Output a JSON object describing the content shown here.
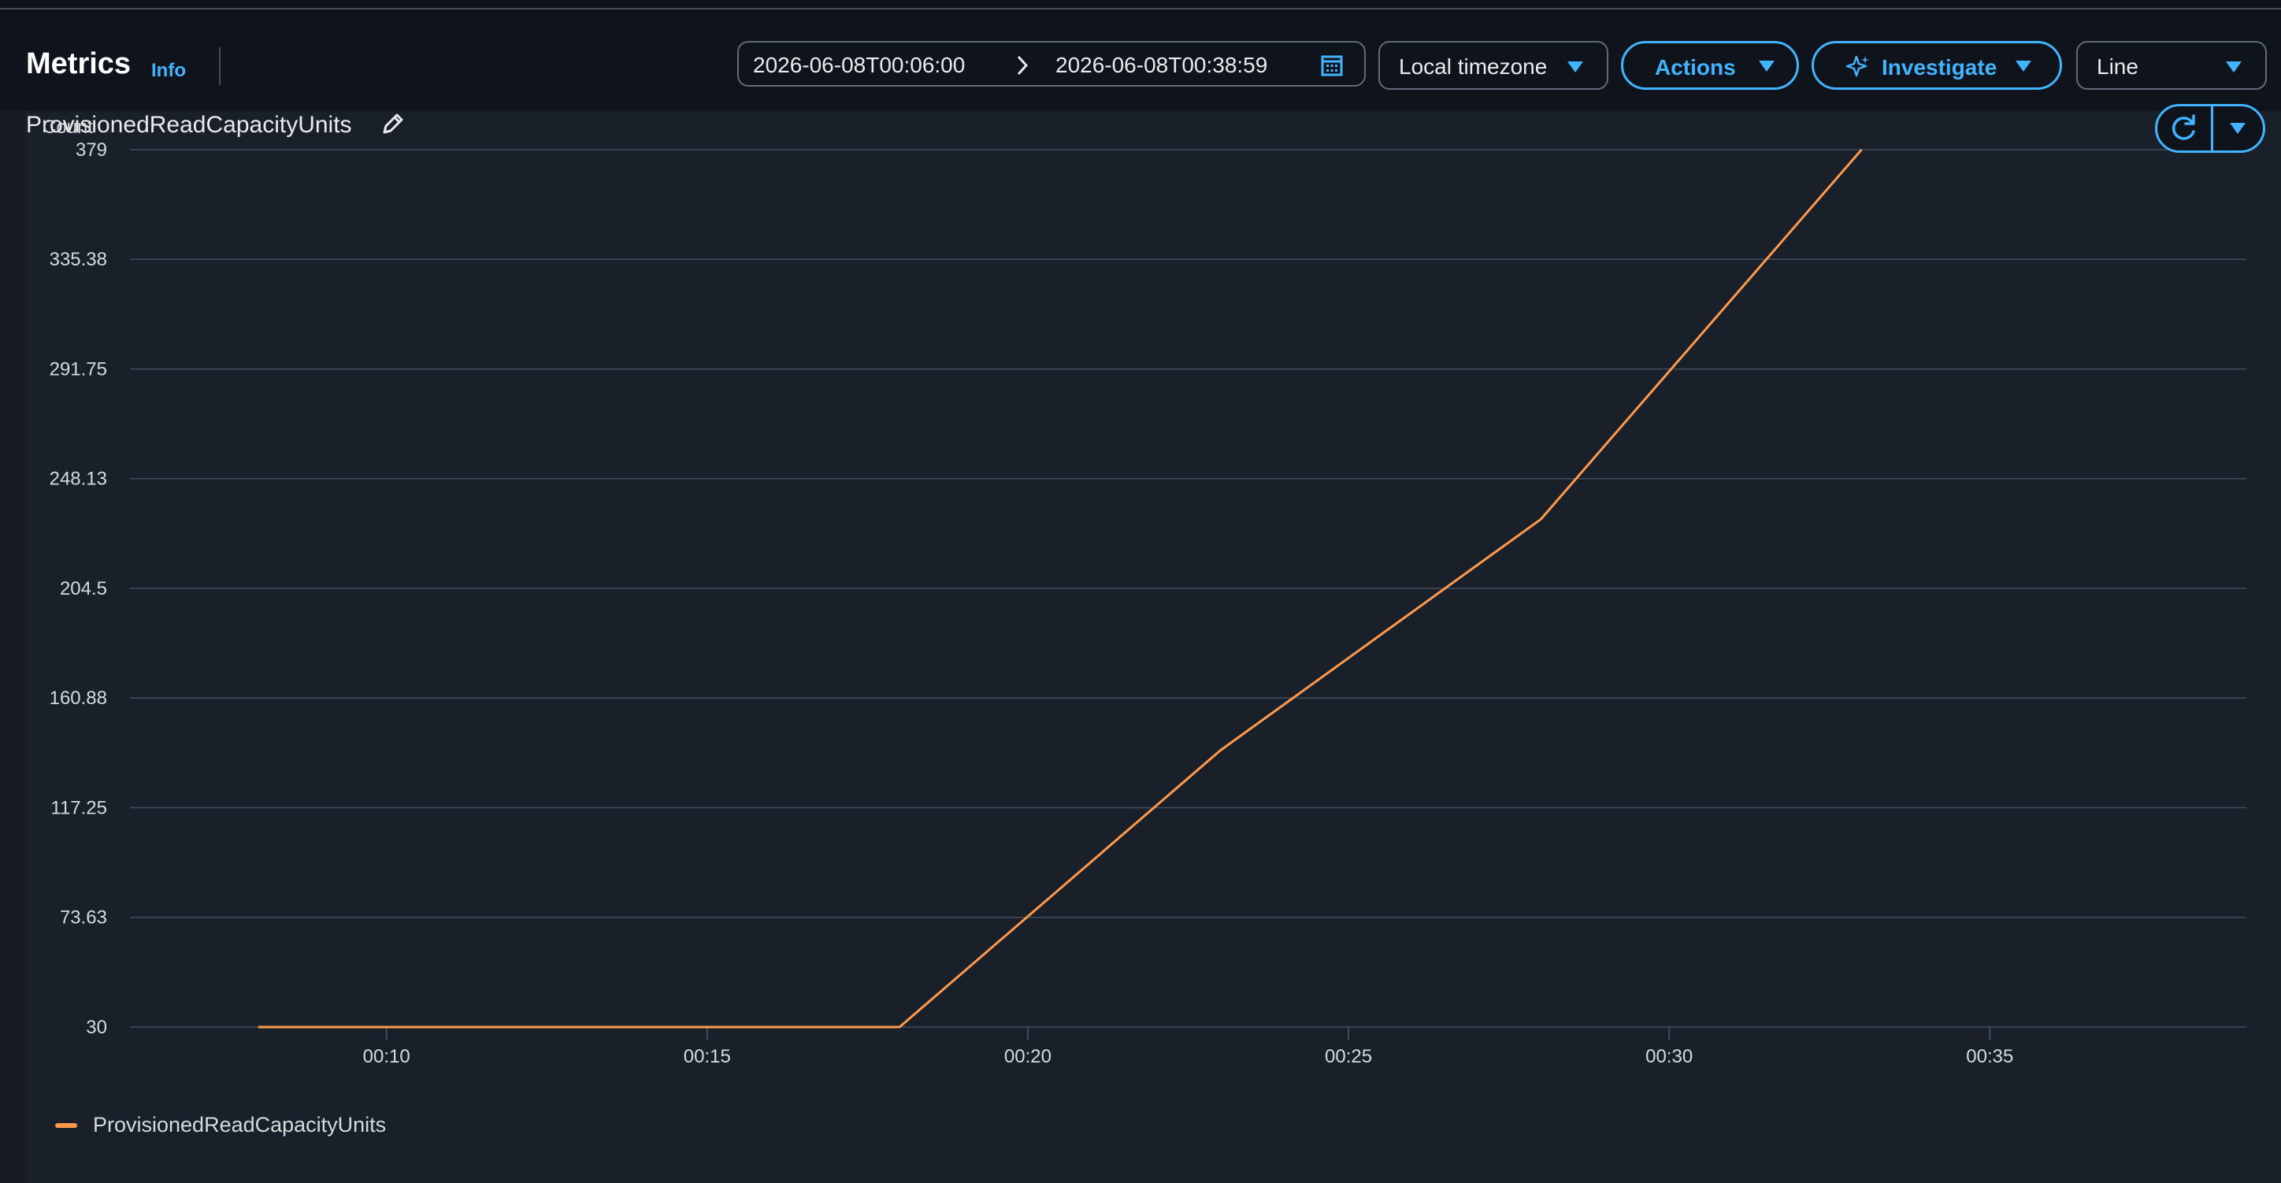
{
  "header": {
    "title": "Metrics",
    "info_link": "Info"
  },
  "time_range": {
    "start": "2026-06-08T00:06:00",
    "end": "2026-06-08T00:38:59"
  },
  "timezone": {
    "selected": "Local timezone"
  },
  "actions": {
    "label": "Actions"
  },
  "investigate": {
    "label": "Investigate"
  },
  "view_type": {
    "selected": "Line"
  },
  "widget": {
    "title": "ProvisionedReadCapacityUnits"
  },
  "colors": {
    "accent": "#42b4ff",
    "series": "#ff9a4d",
    "grid": "#414d5c"
  },
  "icons": {
    "arrow": "chevron-right-icon",
    "calendar": "calendar-icon",
    "investigate": "sparkle-icon",
    "edit": "pencil-icon",
    "refresh": "refresh-icon",
    "menu": "caret-down-icon"
  },
  "chart_data": {
    "type": "line",
    "ylabel": "Count",
    "xlabel": "",
    "ylim": [
      30,
      379
    ],
    "xlim_minutes": [
      "00:06",
      "00:38:59"
    ],
    "y_ticks": [
      "379",
      "335.38",
      "291.75",
      "248.13",
      "204.5",
      "160.88",
      "117.25",
      "73.63",
      "30"
    ],
    "x_ticks": [
      "00:10",
      "00:15",
      "00:20",
      "00:25",
      "00:30",
      "00:35"
    ],
    "grid": true,
    "legend_position": "bottom-left",
    "series": [
      {
        "name": "ProvisionedReadCapacityUnits",
        "x": [
          "00:08",
          "00:13",
          "00:18",
          "00:23",
          "00:28",
          "00:33"
        ],
        "values": [
          30,
          30,
          30,
          140,
          232,
          379
        ]
      }
    ]
  }
}
